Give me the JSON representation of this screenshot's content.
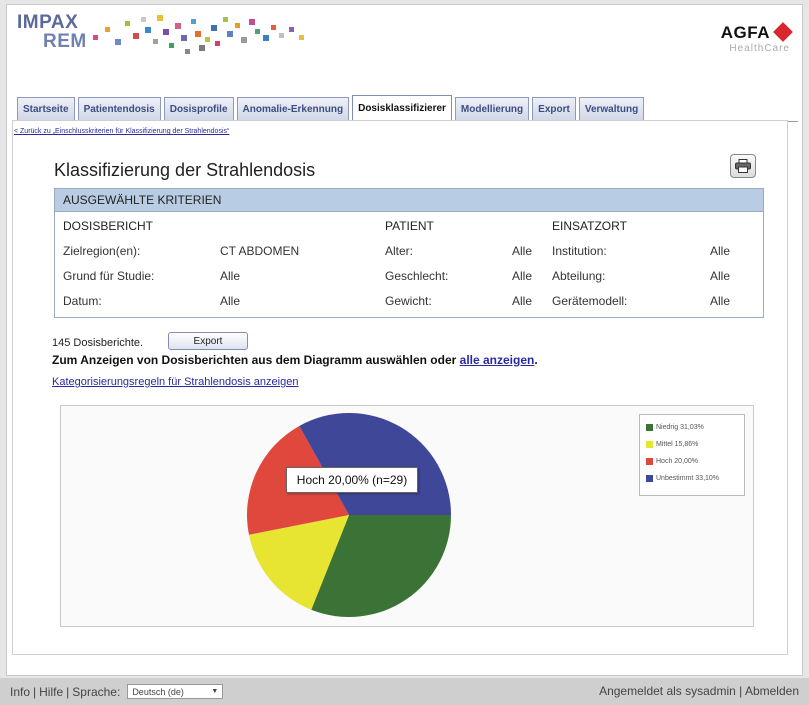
{
  "header": {
    "logo_line1": "IMPAX",
    "logo_line2": "REM",
    "brand": "AGFA",
    "brand_sub": "HealthCare"
  },
  "tabs": [
    {
      "label": "Startseite"
    },
    {
      "label": "Patientendosis"
    },
    {
      "label": "Dosisprofile"
    },
    {
      "label": "Anomalie-Erkennung"
    },
    {
      "label": "Dosisklassifizierer",
      "active": true
    },
    {
      "label": "Modellierung"
    },
    {
      "label": "Export"
    },
    {
      "label": "Verwaltung"
    }
  ],
  "back_link": "< Zurück zu „Einschlusskriterien für Klassifizierung der Strahlendosis“",
  "page_title": "Klassifizierung der Strahlendosis",
  "criteria": {
    "heading": "AUSGEWÄHLTE KRITERIEN",
    "section_report": "DOSISBERICHT",
    "section_patient": "PATIENT",
    "section_location": "EINSATZORT",
    "report": [
      {
        "label": "Zielregion(en):",
        "value": "CT ABDOMEN"
      },
      {
        "label": "Grund für Studie:",
        "value": "Alle"
      },
      {
        "label": "Datum:",
        "value": "Alle"
      }
    ],
    "patient": [
      {
        "label": "Alter:",
        "value": "Alle"
      },
      {
        "label": "Geschlecht:",
        "value": "Alle"
      },
      {
        "label": "Gewicht:",
        "value": "Alle"
      }
    ],
    "location": [
      {
        "label": "Institution:",
        "value": "Alle"
      },
      {
        "label": "Abteilung:",
        "value": "Alle"
      },
      {
        "label": "Gerätemodell:",
        "value": "Alle"
      }
    ]
  },
  "results": {
    "count_text": "145 Dosisberichte.",
    "export_label": "Export",
    "instruction_text": "Zum Anzeigen von Dosisberichten aus dem Diagramm auswählen oder ",
    "show_all_link": "alle anzeigen",
    "instruction_end": ".",
    "rules_link": "Kategorisierungsregeln für Strahlendosis anzeigen"
  },
  "chart_data": {
    "type": "pie",
    "slices": [
      {
        "name": "Niedrig",
        "value": 31.03,
        "label": "Niedrig 31,03%",
        "color": "#3b7336"
      },
      {
        "name": "Mittel",
        "value": 15.86,
        "label": "Mittel 15,86%",
        "color": "#e8e432"
      },
      {
        "name": "Hoch",
        "value": 20.0,
        "label": "Hoch 20,00%",
        "color": "#e0473d"
      },
      {
        "name": "Unbestimmt",
        "value": 33.1,
        "label": "Unbestimmt 33,10%",
        "color": "#3f4799"
      }
    ],
    "tooltip": "Hoch 20,00% (n=29)",
    "legend_position": "top-right"
  },
  "footer": {
    "info": "Info",
    "help": "Hilfe",
    "language_label": "Sprache:",
    "language_value": "Deutsch (de)",
    "logged_in": "Angemeldet als sysadmin",
    "logout": "Abmelden"
  }
}
